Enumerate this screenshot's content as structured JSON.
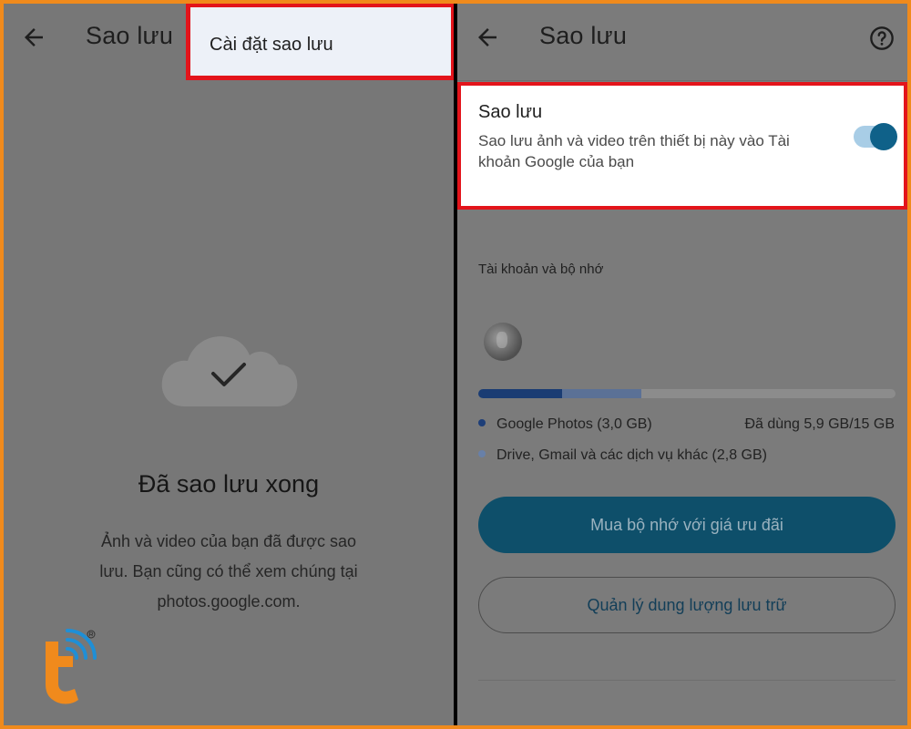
{
  "left_panel": {
    "title": "Sao lưu",
    "icons": {
      "back": "arrow-left-icon",
      "cloud": "cloud-check-icon",
      "logo": "brand-logo-icon"
    },
    "menu": {
      "item_label": "Cài đặt sao lưu"
    },
    "status_title": "Đã sao lưu xong",
    "status_desc_line1": "Ảnh và video của bạn đã được sao",
    "status_desc_line2": "lưu. Bạn cũng có thể xem chúng tại",
    "status_desc_line3": "photos.google.com."
  },
  "right_panel": {
    "title": "Sao lưu",
    "icons": {
      "back": "arrow-left-icon",
      "help": "help-circle-icon"
    },
    "backup_setting": {
      "title": "Sao lưu",
      "desc_line1": "Sao lưu ảnh và video trên thiết bị này vào Tài",
      "desc_line2": "khoản Google của bạn",
      "enabled": true
    },
    "storage": {
      "section_label": "Tài khoản và bộ nhớ",
      "photos_label": "Google Photos (3,0 GB)",
      "other_label": "Drive, Gmail và các dịch vụ khác (2,8 GB)",
      "used_label": "Đã dùng 5,9 GB/15 GB",
      "photos_fraction": 0.2,
      "other_fraction": 0.19
    },
    "buttons": {
      "buy": "Mua bộ nhớ với giá ưu đãi",
      "manage": "Quản lý dung lượng lưu trữ"
    }
  },
  "colors": {
    "frame": "#f08a1c",
    "highlight_border": "#e3141b",
    "toggle_on": "#0f6189",
    "button_primary": "#0e4f6a"
  }
}
